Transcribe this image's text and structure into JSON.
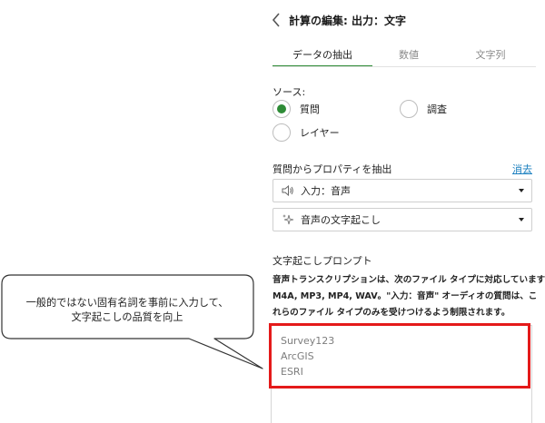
{
  "header": {
    "title": "計算の編集: 出力：文字"
  },
  "tabs": [
    {
      "label": "データの抽出",
      "active": true
    },
    {
      "label": "数値",
      "active": false
    },
    {
      "label": "文字列",
      "active": false
    }
  ],
  "source": {
    "label": "ソース:",
    "options": [
      {
        "label": "質問",
        "selected": true
      },
      {
        "label": "調査",
        "selected": false
      },
      {
        "label": "レイヤー",
        "selected": false
      }
    ]
  },
  "extract": {
    "label": "質問からプロパティを抽出",
    "clear_link": "消去",
    "question_select": {
      "value": "入力：音声",
      "icon": "speaker-icon"
    },
    "property_select": {
      "value": "音声の文字起こし",
      "icon": "sparkle-icon"
    }
  },
  "prompt": {
    "label": "文字起こしプロンプト",
    "description_lines": [
      "音声トランスクリプションは、次のファイル タイプに対応しています:",
      "M4A, MP3, MP4, WAV。\"入力：音声\" オーディオの質問は、こ",
      "れらのファイル タイプのみを受けつけるよう制限されます。"
    ],
    "textarea_lines": [
      "Survey123",
      "ArcGIS",
      "ESRI"
    ]
  },
  "callout": {
    "lines": [
      "一般的ではない固有名詞を事前に入力して、",
      "文字起こしの品質を向上"
    ]
  },
  "colors": {
    "accent_green": "#2e8b36",
    "link_blue": "#1a7fbf",
    "highlight_red": "#e41a1a"
  }
}
